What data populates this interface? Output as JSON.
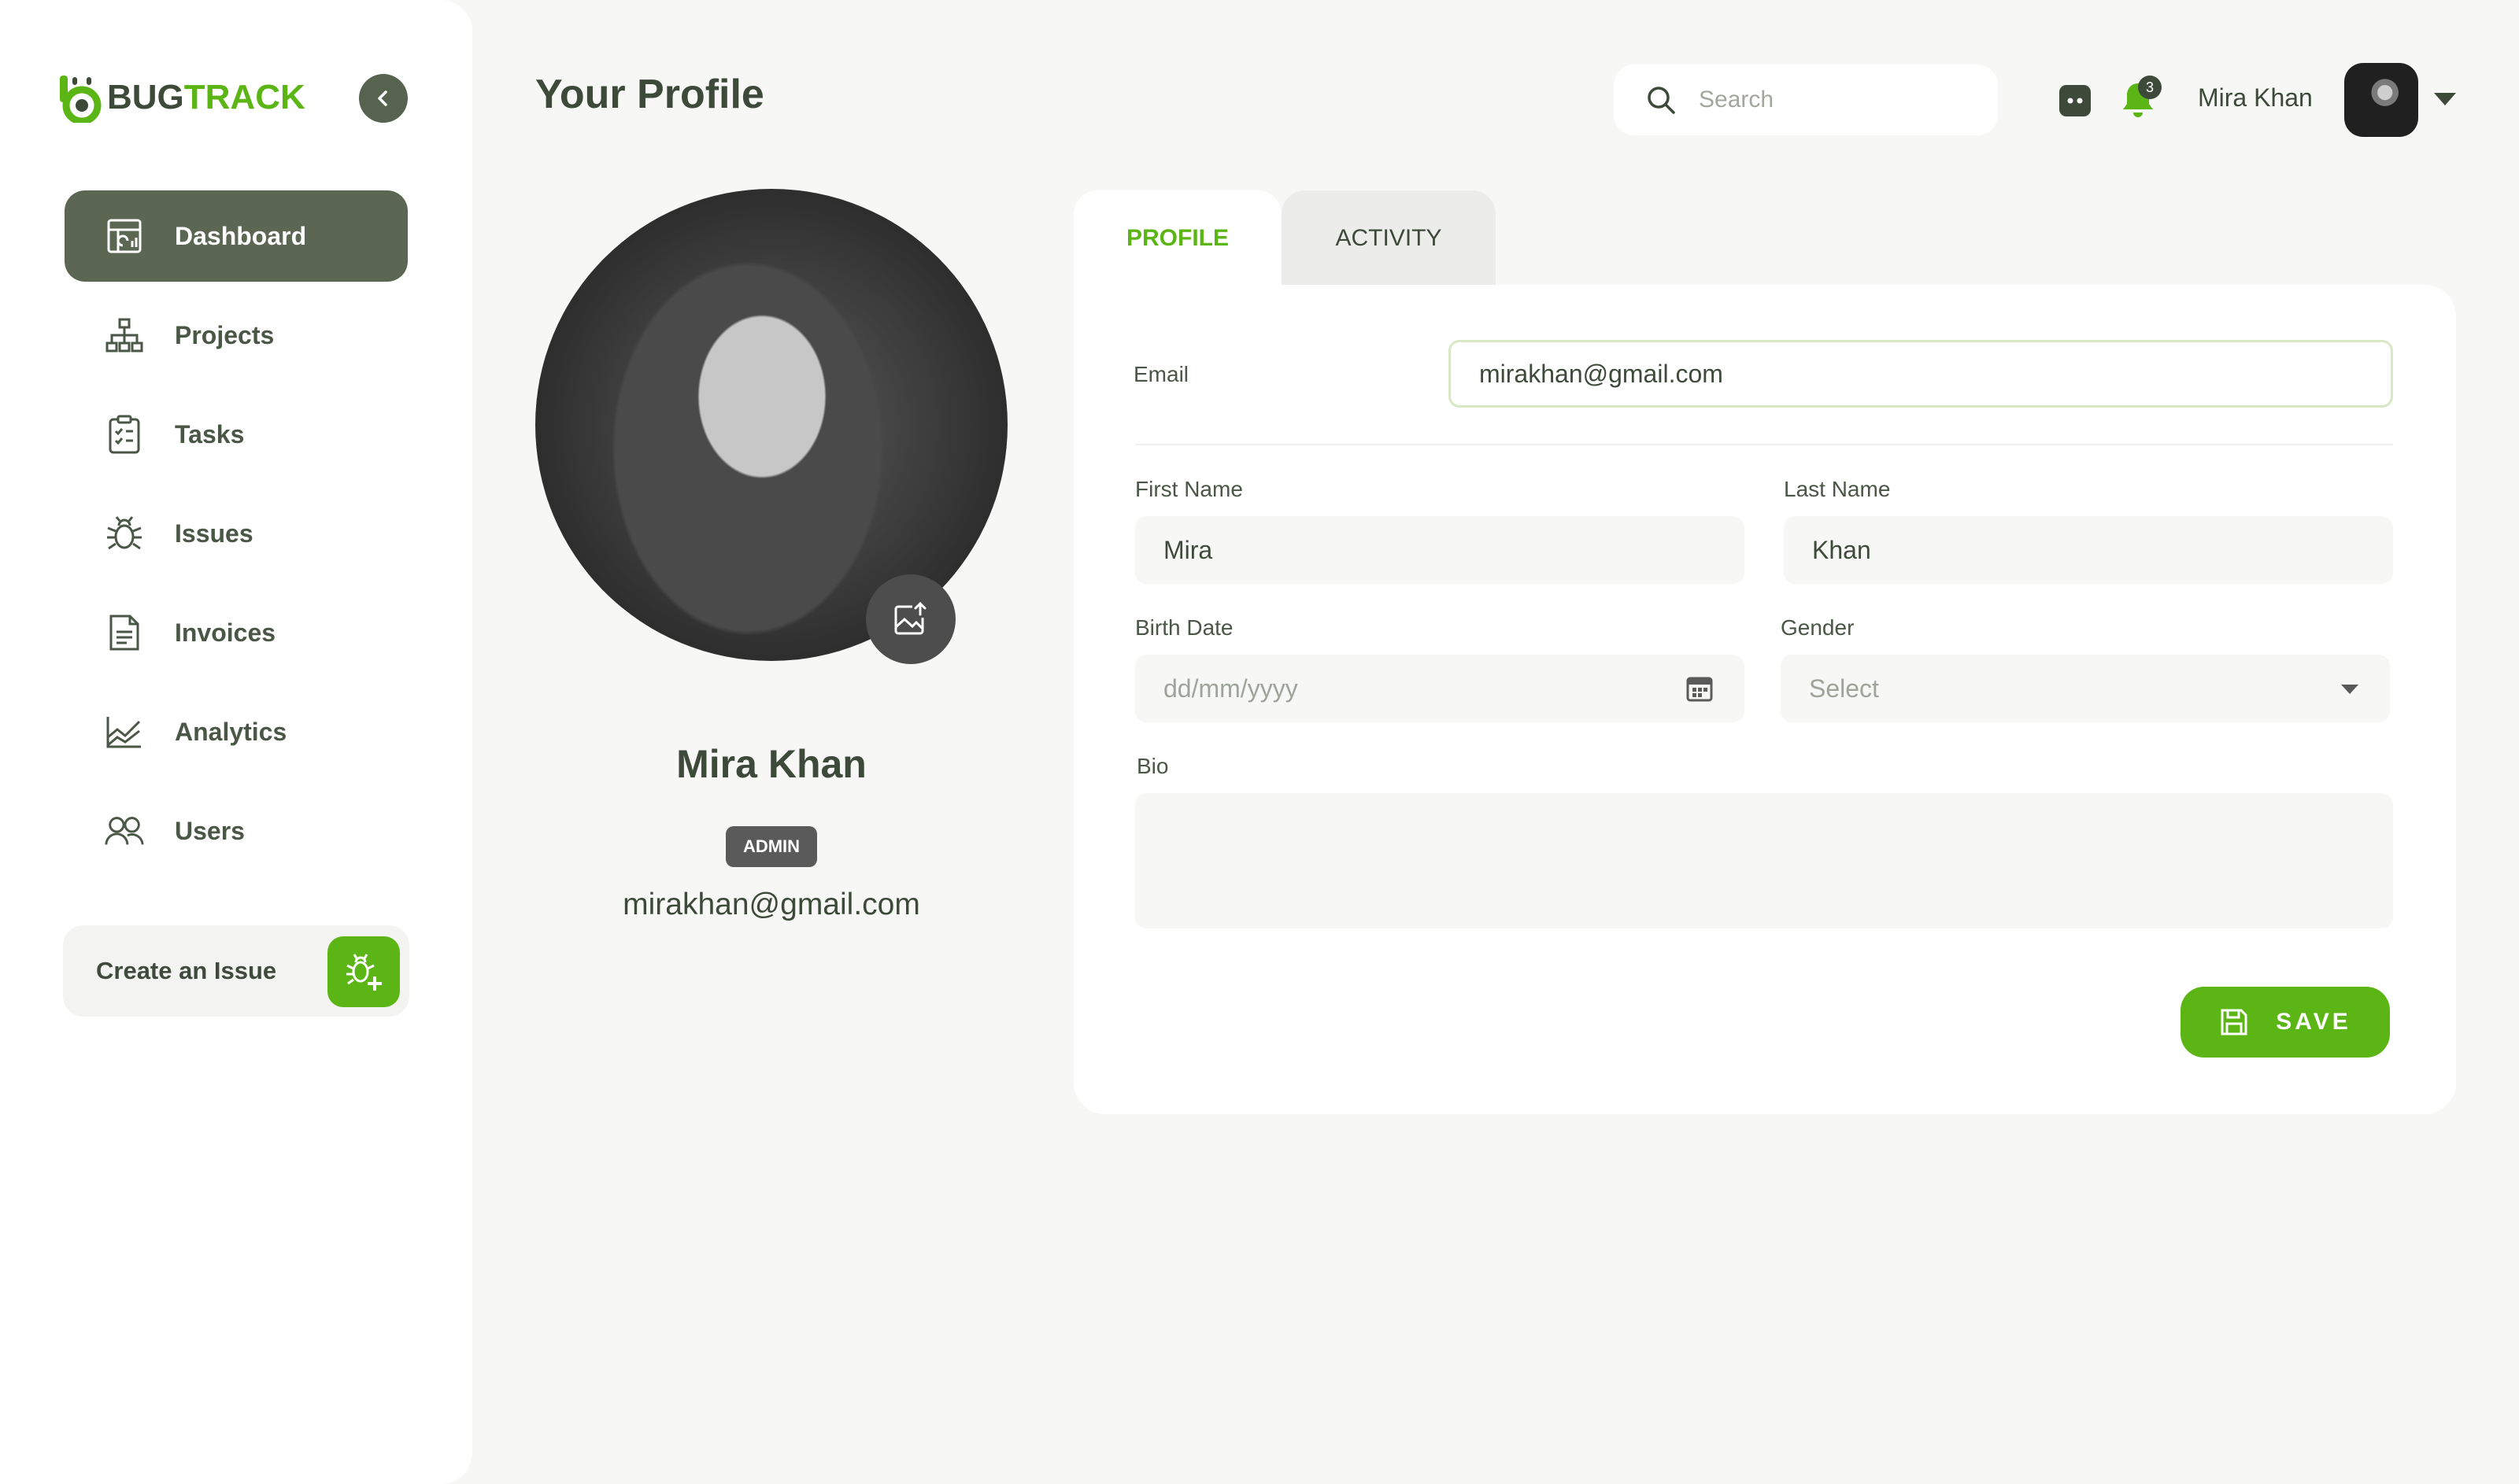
{
  "brand": {
    "name_part1": "BUG",
    "name_part2": "TRACK",
    "accent": "#5bb514"
  },
  "sidebar": {
    "items": [
      {
        "label": "Dashboard",
        "icon": "dashboard-icon",
        "active": true
      },
      {
        "label": "Projects",
        "icon": "hierarchy-icon",
        "active": false
      },
      {
        "label": "Tasks",
        "icon": "clipboard-checklist-icon",
        "active": false
      },
      {
        "label": "Issues",
        "icon": "bug-icon",
        "active": false
      },
      {
        "label": "Invoices",
        "icon": "invoice-icon",
        "active": false
      },
      {
        "label": "Analytics",
        "icon": "analytics-chart-icon",
        "active": false
      },
      {
        "label": "Users",
        "icon": "users-icon",
        "active": false
      }
    ],
    "create_issue_label": "Create an Issue"
  },
  "header": {
    "title": "Your Profile",
    "search_placeholder": "Search",
    "notifications_count": "3",
    "user_name": "Mira Khan"
  },
  "profile": {
    "name": "Mira Khan",
    "role": "ADMIN",
    "email": "mirakhan@gmail.com"
  },
  "tabs": [
    {
      "label": "PROFILE",
      "active": true
    },
    {
      "label": "ACTIVITY",
      "active": false
    }
  ],
  "form": {
    "email_label": "Email",
    "email_value": "mirakhan@gmail.com",
    "first_name_label": "First Name",
    "first_name_value": "Mira",
    "last_name_label": "Last Name",
    "last_name_value": "Khan",
    "birth_date_label": "Birth Date",
    "birth_date_placeholder": "dd/mm/yyyy",
    "gender_label": "Gender",
    "gender_value": "Select",
    "bio_label": "Bio",
    "save_label": "SAVE"
  }
}
